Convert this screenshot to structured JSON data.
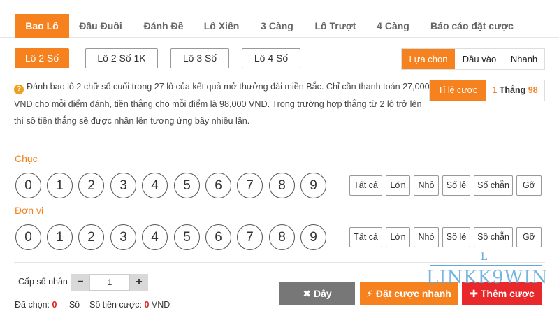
{
  "tabs": [
    {
      "label": "Bao Lô",
      "active": true
    },
    {
      "label": "Đầu Đuôi"
    },
    {
      "label": "Đánh Đề"
    },
    {
      "label": "Lô Xiên"
    },
    {
      "label": "3 Càng"
    },
    {
      "label": "Lô Trượt"
    },
    {
      "label": "4 Càng"
    },
    {
      "label": "Báo cáo đặt cược"
    }
  ],
  "sub_tabs": [
    {
      "label": "Lô 2 Số",
      "active": true
    },
    {
      "label": "Lô 2 Số 1K"
    },
    {
      "label": "Lô 3 Số"
    },
    {
      "label": "Lô 4 Số"
    }
  ],
  "modes": [
    {
      "label": "Lựa chọn",
      "active": true
    },
    {
      "label": "Đầu vào"
    },
    {
      "label": "Nhanh"
    }
  ],
  "info": {
    "icon": "question-icon",
    "text": "Đánh bao lô 2 chữ số cuối trong 27 lô của kết quả mở thưởng đài miền Bắc. Chỉ cần thanh toán 27,000 VND cho mỗi điểm đánh, tiền thắng cho mỗi điểm là 98,000 VND. Trong trường hợp thắng từ 2 lô trở lên thì số tiền thắng sẽ được nhân lên tương ứng bấy nhiêu lần."
  },
  "rate": {
    "label": "Tỉ lệ cược",
    "left": "1",
    "middle": "Thắng",
    "right": "98"
  },
  "rows": [
    {
      "label": "Chục",
      "balls": [
        "0",
        "1",
        "2",
        "3",
        "4",
        "5",
        "6",
        "7",
        "8",
        "9"
      ],
      "quick": [
        "Tất cả",
        "Lớn",
        "Nhỏ",
        "Số lẻ",
        "Số chẵn",
        "Gỡ"
      ]
    },
    {
      "label": "Đơn vị",
      "balls": [
        "0",
        "1",
        "2",
        "3",
        "4",
        "5",
        "6",
        "7",
        "8",
        "9"
      ],
      "quick": [
        "Tất cả",
        "Lớn",
        "Nhỏ",
        "Số lẻ",
        "Số chẵn",
        "Gỡ"
      ]
    }
  ],
  "multiplier": {
    "label": "Cấp số nhân",
    "minus": "−",
    "value": "1",
    "plus": "+"
  },
  "summary": {
    "selected_label": "Đã chọn:",
    "selected_value": "0",
    "selected_unit": "Số",
    "amount_label": "Số tiền cược:",
    "amount_value": "0",
    "amount_unit": "VND"
  },
  "actions": {
    "clear_icon": "✖",
    "clear": "Dây",
    "quick_icon": "⚡",
    "quick": "Đặt cược nhanh",
    "add_icon": "✚",
    "add": "Thêm cược"
  },
  "watermark": {
    "top": "L",
    "text": "LINKK9WIN"
  },
  "colors": {
    "accent": "#f5821f",
    "danger": "#e8282a",
    "neutral": "#777777"
  }
}
